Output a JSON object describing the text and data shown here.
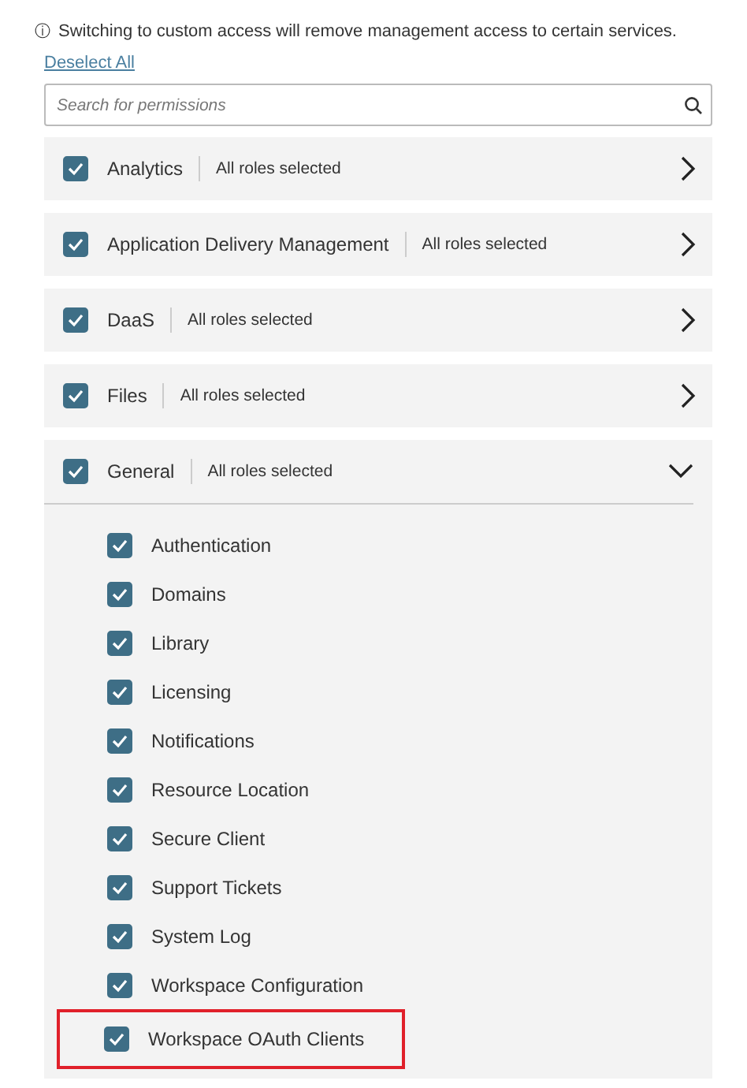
{
  "notice": {
    "icon": "ⓘ",
    "text": "Switching to custom access will remove management access to certain services."
  },
  "deselect_link": "Deselect All",
  "search": {
    "placeholder": "Search for permissions"
  },
  "groups": [
    {
      "name": "Analytics",
      "status": "All roles selected",
      "checked": true,
      "expanded": false
    },
    {
      "name": "Application Delivery Management",
      "status": "All roles selected",
      "checked": true,
      "expanded": false
    },
    {
      "name": "DaaS",
      "status": "All roles selected",
      "checked": true,
      "expanded": false
    },
    {
      "name": "Files",
      "status": "All roles selected",
      "checked": true,
      "expanded": false
    },
    {
      "name": "General",
      "status": "All roles selected",
      "checked": true,
      "expanded": true,
      "children": [
        {
          "name": "Authentication",
          "checked": true,
          "highlighted": false
        },
        {
          "name": "Domains",
          "checked": true,
          "highlighted": false
        },
        {
          "name": "Library",
          "checked": true,
          "highlighted": false
        },
        {
          "name": "Licensing",
          "checked": true,
          "highlighted": false
        },
        {
          "name": "Notifications",
          "checked": true,
          "highlighted": false
        },
        {
          "name": "Resource Location",
          "checked": true,
          "highlighted": false
        },
        {
          "name": "Secure Client",
          "checked": true,
          "highlighted": false
        },
        {
          "name": "Support Tickets",
          "checked": true,
          "highlighted": false
        },
        {
          "name": "System Log",
          "checked": true,
          "highlighted": false
        },
        {
          "name": "Workspace Configuration",
          "checked": true,
          "highlighted": false
        },
        {
          "name": "Workspace OAuth Clients",
          "checked": true,
          "highlighted": true
        }
      ]
    }
  ]
}
